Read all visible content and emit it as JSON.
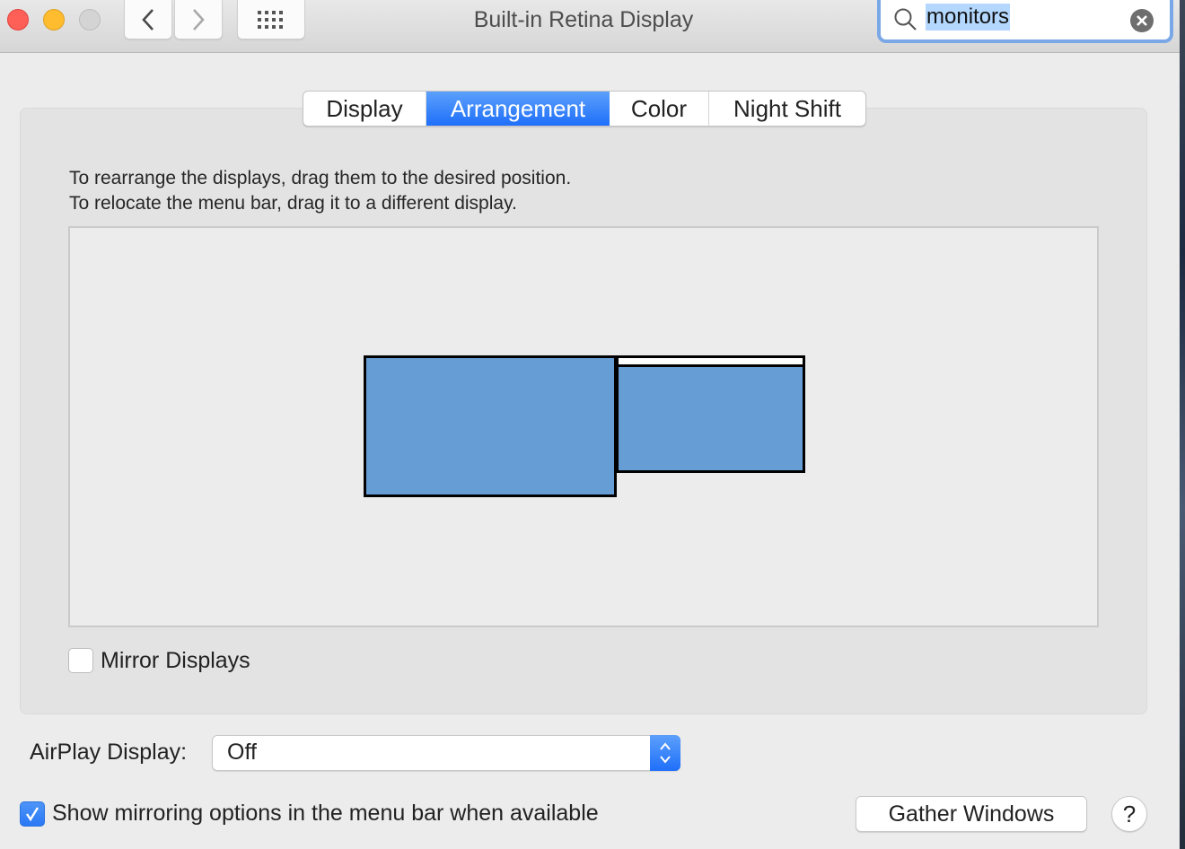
{
  "window": {
    "title": "Built-in Retina Display",
    "traffic_lights": [
      "close",
      "minimize",
      "zoom"
    ],
    "nav": {
      "back_icon": "chevron-left-icon",
      "forward_icon": "chevron-right-icon",
      "grid_icon": "show-all-grid-icon"
    },
    "search": {
      "value": "monitors",
      "icon": "search-icon",
      "clear_icon": "clear-icon"
    }
  },
  "tabs": [
    {
      "label": "Display",
      "active": false
    },
    {
      "label": "Arrangement",
      "active": true
    },
    {
      "label": "Color",
      "active": false
    },
    {
      "label": "Night Shift",
      "active": false
    }
  ],
  "arrangement": {
    "instruction_line1": "To rearrange the displays, drag them to the desired position.",
    "instruction_line2": "To relocate the menu bar, drag it to a different display.",
    "displays": [
      {
        "name": "primary-display",
        "has_menu_bar": false
      },
      {
        "name": "secondary-display",
        "has_menu_bar": true
      }
    ],
    "colors": {
      "display_fill": "#659dd4",
      "display_border": "#000000",
      "menu_bar": "#ffffff"
    }
  },
  "mirror_displays": {
    "label": "Mirror Displays",
    "checked": false
  },
  "airplay": {
    "label": "AirPlay Display:",
    "selected": "Off"
  },
  "show_mirroring": {
    "label": "Show mirroring options in the menu bar when available",
    "checked": true
  },
  "buttons": {
    "gather_windows": "Gather Windows",
    "help": "?"
  },
  "accent_color": "#2a78f5"
}
